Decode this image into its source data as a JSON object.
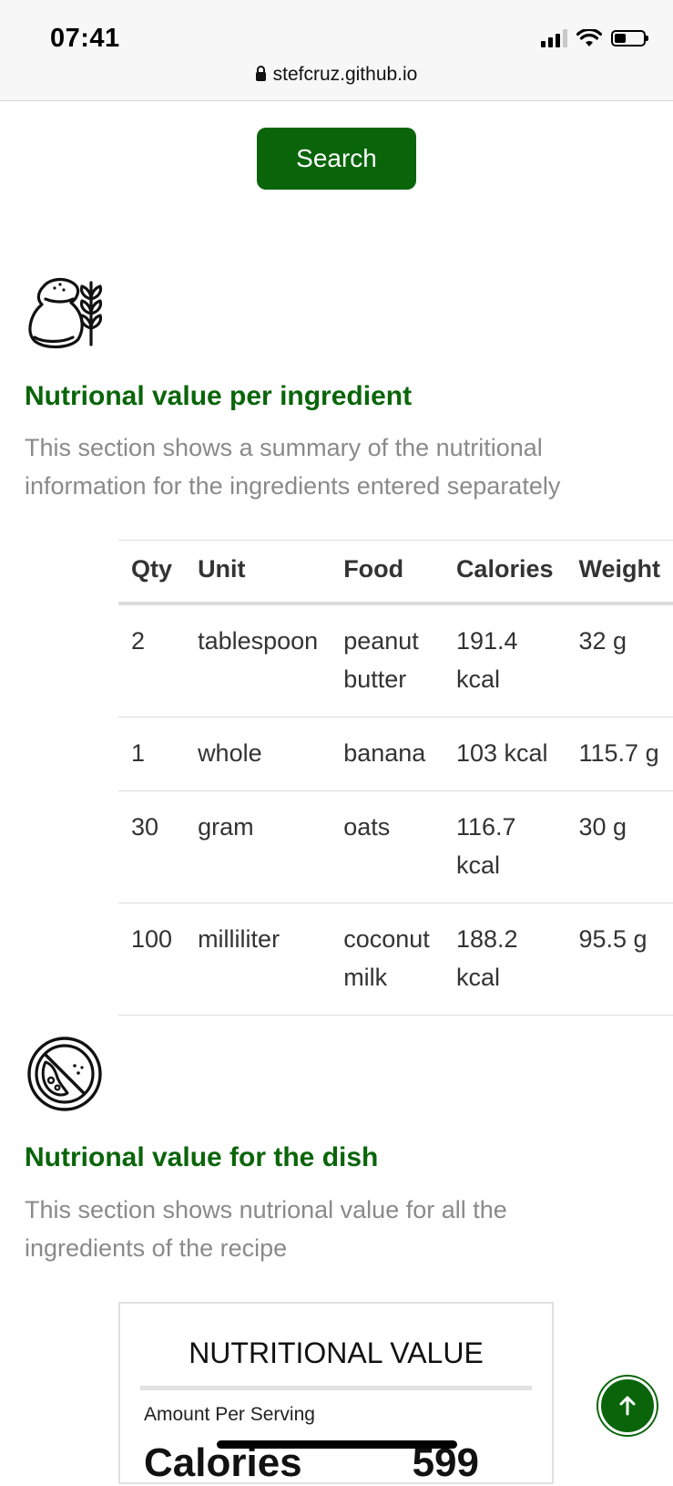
{
  "status_bar": {
    "time": "07:41"
  },
  "browser": {
    "url": "stefcruz.github.io"
  },
  "search": {
    "label": "Search"
  },
  "ingredients_section": {
    "title": "Nutrional value per ingredient",
    "description": "This section shows a summary of the nutritional information for the ingredients entered separately",
    "icon": "flour-bag-wheat-icon",
    "table": {
      "headers": [
        "Qty",
        "Unit",
        "Food",
        "Calories",
        "Weight"
      ],
      "rows": [
        [
          "2",
          "tablespoon",
          "peanut butter",
          "191.4 kcal",
          "32 g"
        ],
        [
          "1",
          "whole",
          "banana",
          "103 kcal",
          "115.7 g"
        ],
        [
          "30",
          "gram",
          "oats",
          "116.7 kcal",
          "30 g"
        ],
        [
          "100",
          "milliliter",
          "coconut milk",
          "188.2 kcal",
          "95.5 g"
        ]
      ]
    }
  },
  "dish_section": {
    "title": "Nutrional value for the dish",
    "description": "This section shows nutrional value for all the ingredients of the recipe",
    "icon": "no-allergen-icon",
    "label_box": {
      "title": "NUTRITIONAL VALUE",
      "amount_label": "Amount Per Serving",
      "calories_label": "Calories",
      "calories_value": "599"
    }
  },
  "colors": {
    "accent": "#0a650a",
    "muted_text": "#8a8a8a"
  }
}
